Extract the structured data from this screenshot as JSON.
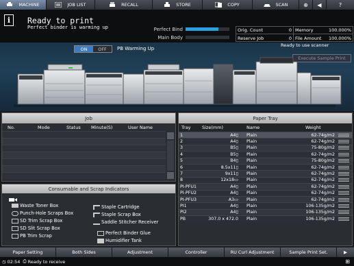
{
  "tabs": [
    {
      "label": "MACHINE",
      "icon": "printer-icon",
      "active": true
    },
    {
      "label": "JOB LIST",
      "icon": "list-icon",
      "active": false
    },
    {
      "label": "RECALL",
      "icon": "printer-recall-icon",
      "active": false
    },
    {
      "label": "STORE",
      "icon": "store-icon",
      "active": false
    },
    {
      "label": "COPY",
      "icon": "copy-icon",
      "active": false
    },
    {
      "label": "SCAN",
      "icon": "scan-icon",
      "active": false
    }
  ],
  "status": {
    "title": "Ready to print",
    "subtitle": "Perfect binder is warming up",
    "perfect_bind_label": "Perfect Bind",
    "main_body_label": "Main Body",
    "perfect_bind_level": 0.75
  },
  "counters": {
    "orig_count_label": "Orig. Count",
    "orig_count": "0",
    "memory_label": "Memory",
    "memory": "100.000%",
    "reserve_job_label": "Reserve Job",
    "reserve_job": "0",
    "file_amount_label": "File Amount",
    "file_amount": "100.000%"
  },
  "machine": {
    "toggle_on": "ON",
    "toggle_off": "OFF",
    "pb_warming_label": "PB Warming Up",
    "ready_scan": "Ready to use scanner",
    "execute_sample": "Execute Sample Print"
  },
  "job": {
    "title": "Job",
    "headers": [
      "No.",
      "Mode",
      "Status",
      "Minute(S)",
      "User Name"
    ]
  },
  "paper_tray": {
    "title": "Paper Tray",
    "headers": [
      "Tray",
      "Size(mm)",
      "Name",
      "Weight"
    ],
    "rows": [
      {
        "tray": "1",
        "size": "A4▯",
        "name": "Plain",
        "weight": "62-74g/m2"
      },
      {
        "tray": "2",
        "size": "A4▯",
        "name": "Plain",
        "weight": "62-74g/m2"
      },
      {
        "tray": "3",
        "size": "B5▯",
        "name": "Plain",
        "weight": "75-80g/m2"
      },
      {
        "tray": "4",
        "size": "B5▯",
        "name": "Plain",
        "weight": "62-74g/m2"
      },
      {
        "tray": "5",
        "size": "B4▯",
        "name": "Plain",
        "weight": "75-80g/m2"
      },
      {
        "tray": "6",
        "size": "8.5x11▯",
        "name": "Plain",
        "weight": "62-74g/m2"
      },
      {
        "tray": "7",
        "size": "9x11▯",
        "name": "Plain",
        "weight": "62-74g/m2"
      },
      {
        "tray": "8",
        "size": "12x18▭",
        "name": "Plain",
        "weight": "62-74g/m2"
      },
      {
        "tray": "PI-PFU1",
        "size": "A4▯",
        "name": "Plain",
        "weight": "62-74g/m2"
      },
      {
        "tray": "PI-PFU2",
        "size": "A4▯",
        "name": "Plain",
        "weight": "62-74g/m2"
      },
      {
        "tray": "PI-PFU3",
        "size": "A3▭",
        "name": "Plain",
        "weight": "62-74g/m2"
      },
      {
        "tray": "PI1",
        "size": "A4▯",
        "name": "Plain",
        "weight": "106-135g/m2"
      },
      {
        "tray": "PI2",
        "size": "A4▯",
        "name": "Plain",
        "weight": "106-135g/m2"
      },
      {
        "tray": "PB",
        "size": "307.0 x 472.0",
        "name": "Plain",
        "weight": "106-135g/m2"
      }
    ]
  },
  "consumables": {
    "title": "Consumable and Scrap Indicators",
    "left": [
      "Waste Toner Box",
      "Punch-Hole Scraps Box",
      "SD Trim Scrap Box",
      "SD Slit Scrap Box",
      "PB Trim Scrap"
    ],
    "right": [
      "Staple Cartridge",
      "Staple Scrap Box",
      "Saddle Stitcher Receiver",
      "Perfect Binder Glue",
      "Humidifier Tank"
    ]
  },
  "bottom_buttons": [
    "Paper Setting",
    "Both Sides",
    "Adjustment",
    "Controller",
    "RU Curl Adjustment",
    "Sample Print Set."
  ],
  "footer": {
    "time": "02:54",
    "message": "Ready to receive"
  }
}
